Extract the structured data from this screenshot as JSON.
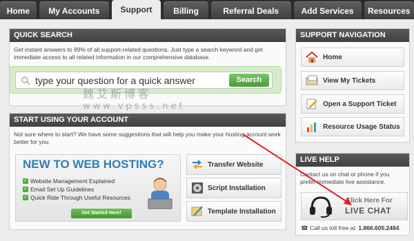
{
  "nav": {
    "tabs": [
      "Home",
      "My Accounts",
      "Support",
      "Billing",
      "Referral Deals",
      "Add Services",
      "Resources"
    ],
    "active": "Support"
  },
  "quick_search": {
    "title": "QUICK SEARCH",
    "description": "Get instant answers to 99% of all support-related questions. Just type a search keyword and get immediate access to all related information in our comprehensive database.",
    "input_value": "type your question for a quick answer",
    "button_label": "Search"
  },
  "start": {
    "title": "START USING YOUR ACCOUNT",
    "description": "Not sure where to start? We have some suggestions that will help you make your hosting account work better for you.",
    "banner_title": "NEW TO WEB HOSTING?",
    "banner_items": [
      "Website Management Explained",
      "Email Set Up Guidelines",
      "Quick Ride Through Useful Resources"
    ],
    "banner_button": "Get Started Here!",
    "tools": [
      "Transfer Website",
      "Script Installation",
      "Template Installation"
    ]
  },
  "support_nav": {
    "title": "SUPPORT NAVIGATION",
    "items": [
      "Home",
      "View My Tickets",
      "Open a Support Ticket",
      "Resource Usage Status"
    ]
  },
  "live_help": {
    "title": "LIVE HELP",
    "description": "Contact us on chat or phone if you prefer immediate live assistance.",
    "chat_small": "Click Here For",
    "chat_big": "LIVE CHAT",
    "tollfree_label": "Call us toll free at:",
    "tollfree_number": "1.866.605.2484"
  },
  "watermark": {
    "line1": "魏艾斯博客",
    "line2": "www.vpsss.net"
  },
  "colors": {
    "accent_green": "#4a9c3a",
    "banner_blue": "#2a7fb8",
    "arrow_red": "#e02020"
  }
}
